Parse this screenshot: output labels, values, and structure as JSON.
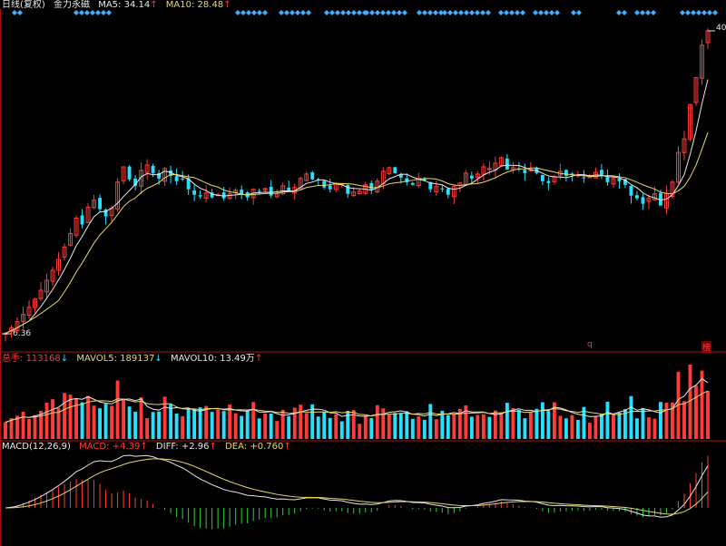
{
  "header": {
    "main_title": "日线(复权)",
    "indicator_name": "金力永磁",
    "ma5_label": "MA5:",
    "ma5_value": "34.14",
    "ma10_label": "MA10:",
    "ma10_value": "28.48"
  },
  "volume_header": {
    "label": "总手:",
    "value": "113168",
    "mavol5_label": "MAVOL5:",
    "mavol5_value": "189137",
    "mavol10_label": "MAVOL10:",
    "mavol10_value": "13.49万"
  },
  "macd_header": {
    "label": "MACD(12,26,9)",
    "macd_label": "MACD:",
    "macd_value": "+4.39",
    "diff_label": "DIFF:",
    "diff_value": "+2.96",
    "dea_label": "DEA:",
    "dea_value": "+0.760"
  },
  "price_axis": {
    "low_label": "6.36",
    "high_label": "40"
  },
  "markers": {
    "q_label": "q",
    "bang_label": "榜"
  },
  "colors": {
    "up": "#ff3b3b",
    "down": "#27e0ff",
    "ma5": "#e8e8e8",
    "ma10": "#e8d86a",
    "separator": "#b01010",
    "diamond": "#3fb0ff"
  },
  "chart_data": [
    {
      "type": "candlestick",
      "title": "日线(复权)",
      "series_close": [
        6.4,
        7.0,
        7.7,
        8.5,
        9.3,
        10.2,
        11.2,
        12.3,
        13.4,
        14.6,
        16,
        17.5,
        19.2,
        18.5,
        20.4,
        21.2,
        20.2,
        19.4,
        20.3,
        23.2,
        24.9,
        23.5,
        22.8,
        24.5,
        25.1,
        24.2,
        23.6,
        24.7,
        23.9,
        23.3,
        23.5,
        22.4,
        21.8,
        21.6,
        22,
        21.5,
        21.8,
        21.4,
        21.9,
        22.3,
        21.8,
        21.5,
        22.4,
        22.2,
        22.5,
        21.7,
        21.9,
        22.8,
        22.2,
        22.6,
        23.6,
        24.1,
        23.5,
        23.4,
        22.6,
        22.4,
        23.1,
        23,
        21.9,
        22.1,
        22.2,
        22.9,
        22.4,
        23.3,
        24.4,
        24.8,
        24.2,
        23.7,
        23.2,
        22.9,
        23.6,
        23.4,
        22.4,
        22.7,
        22.4,
        21.8,
        22.7,
        23.1,
        24.2,
        23.6,
        24.1,
        24.9,
        24.7,
        25.3,
        25.9,
        24.6,
        24.8,
        24.6,
        24.2,
        24.6,
        24.2,
        23.3,
        23.1,
        23.8,
        24.4,
        23.9,
        24.1,
        24,
        23.7,
        23.8,
        24.3,
        24,
        23.2,
        23.6,
        23.3,
        22.9,
        21.7,
        21.4,
        20.8,
        21.4,
        21.9,
        20.6,
        21.9,
        23.2,
        26.5,
        28,
        31.8,
        34.8,
        38.4,
        40
      ]
    },
    {
      "type": "bar",
      "title": "总手",
      "series": [
        {
          "name": "MAVOL5",
          "value_label": "189137"
        },
        {
          "name": "MAVOL10",
          "value_label": "13.49万"
        }
      ]
    },
    {
      "type": "bar",
      "title": "MACD(12,26,9)",
      "series": [
        {
          "name": "DIFF",
          "value_label": "+2.96"
        },
        {
          "name": "DEA",
          "value_label": "+0.760"
        }
      ]
    }
  ]
}
